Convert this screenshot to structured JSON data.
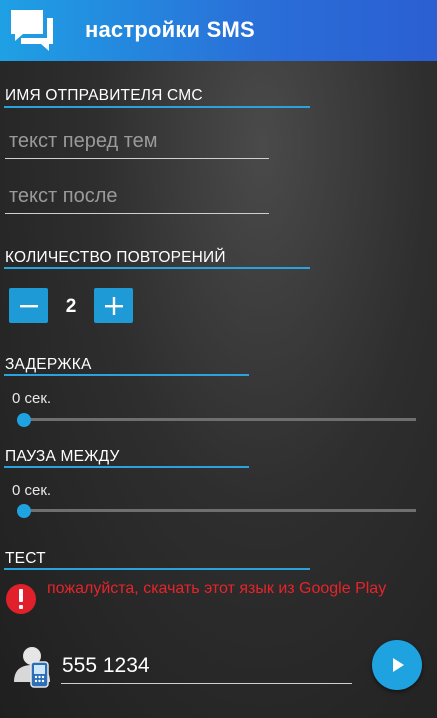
{
  "appbar": {
    "title": "настройки SMS",
    "icon": "chat-bubbles-icon"
  },
  "sender_section": {
    "header": "ИМЯ ОТПРАВИТЕЛЯ СМС",
    "text_before_placeholder": "текст перед тем",
    "text_before_value": "",
    "text_after_placeholder": "текст после",
    "text_after_value": ""
  },
  "repeat_section": {
    "header": "КОЛИЧЕСТВО ПОВТОРЕНИЙ",
    "value": "2",
    "minus_icon": "minus-icon",
    "plus_icon": "plus-icon"
  },
  "delay_section": {
    "header": "ЗАДЕРЖКА",
    "value_label": "0 сек.",
    "slider_fraction": 0
  },
  "pause_section": {
    "header": "ПАУЗА МЕЖДУ",
    "value_label": "0 сек.",
    "slider_fraction": 0
  },
  "test_section": {
    "header": "ТЕСТ",
    "error_message": "пожалуйста, скачать этот язык из Google Play",
    "error_icon": "error-exclamation-icon",
    "phone_value": "555 1234",
    "contact_icon": "contact-phone-icon",
    "send_icon": "play-send-icon"
  },
  "colors": {
    "accent": "#1fa3e0",
    "appbar_start": "#1fa0e4",
    "appbar_end": "#2b5fd2",
    "error": "#e8232a",
    "background": "#2e2e2e"
  }
}
